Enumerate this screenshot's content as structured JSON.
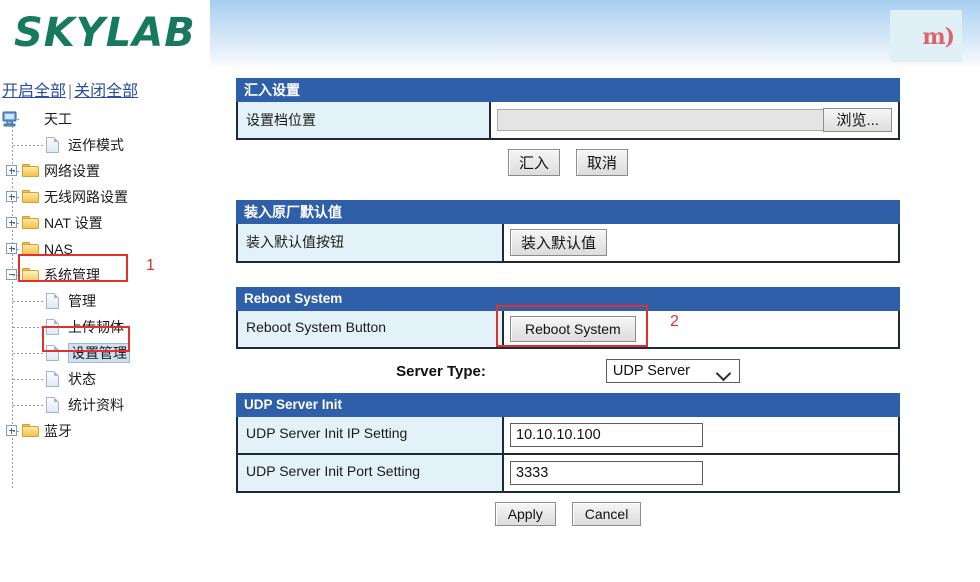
{
  "header": {
    "brand": "SKYLAB",
    "logo_mark": "m)"
  },
  "sidebar": {
    "expand_all": "开启全部",
    "separator": "|",
    "collapse_all": "关闭全部",
    "tree": [
      {
        "label": "天工",
        "icon": "computer-icon",
        "level": 0,
        "toggle": "none",
        "selected": false
      },
      {
        "label": "运作模式",
        "icon": "page-icon",
        "level": 1,
        "toggle": "none",
        "selected": false
      },
      {
        "label": "网络设置",
        "icon": "folder-icon",
        "level": 0,
        "toggle": "plus",
        "selected": false
      },
      {
        "label": "无线网路设置",
        "icon": "folder-icon",
        "level": 0,
        "toggle": "plus",
        "selected": false
      },
      {
        "label": "NAT 设置",
        "icon": "folder-icon",
        "level": 0,
        "toggle": "plus",
        "selected": false
      },
      {
        "label": "NAS",
        "icon": "folder-icon",
        "level": 0,
        "toggle": "plus",
        "selected": false
      },
      {
        "label": "系统管理",
        "icon": "folder-open-icon",
        "level": 0,
        "toggle": "minus",
        "selected": false
      },
      {
        "label": "管理",
        "icon": "page-icon",
        "level": 1,
        "toggle": "none",
        "selected": false
      },
      {
        "label": "上传韧体",
        "icon": "page-icon",
        "level": 1,
        "toggle": "none",
        "selected": false
      },
      {
        "label": "设置管理",
        "icon": "page-icon",
        "level": 1,
        "toggle": "none",
        "selected": true
      },
      {
        "label": "状态",
        "icon": "page-icon",
        "level": 1,
        "toggle": "none",
        "selected": false
      },
      {
        "label": "统计资料",
        "icon": "page-icon",
        "level": 1,
        "toggle": "none",
        "selected": false
      },
      {
        "label": "蓝牙",
        "icon": "folder-icon",
        "level": 0,
        "toggle": "plus",
        "selected": false
      }
    ]
  },
  "annotations": [
    {
      "number": "1",
      "target": "sidebar-item-system-management"
    },
    {
      "number": "2",
      "target": "reboot-system-button"
    }
  ],
  "import_panel": {
    "title": "汇入设置",
    "row_label": "设置档位置",
    "file_value": "",
    "browse_label": "浏览...",
    "import_button": "汇入",
    "cancel_button": "取消"
  },
  "factory_panel": {
    "title": "装入原厂默认值",
    "row_label": "装入默认值按钮",
    "load_button": "装入默认值"
  },
  "reboot_panel": {
    "title": "Reboot System",
    "row_label": "Reboot System Button",
    "reboot_button": "Reboot System"
  },
  "server_type": {
    "label": "Server Type:",
    "selected": "UDP Server",
    "options": [
      "UDP Server"
    ]
  },
  "udp_panel": {
    "title": "UDP Server Init",
    "rows": [
      {
        "label": "UDP Server Init IP Setting",
        "value": "10.10.10.100"
      },
      {
        "label": "UDP Server Init Port Setting",
        "value": "3333"
      }
    ],
    "apply_button": "Apply",
    "cancel_button": "Cancel"
  },
  "colors": {
    "brand_green": "#17795e",
    "panel_header_blue": "#2f5fa8",
    "label_cell_blue": "#e2f2f8",
    "annotation_red": "#e03030",
    "link_blue": "#2a4fa0",
    "selection_blue": "#cfe0f0"
  }
}
